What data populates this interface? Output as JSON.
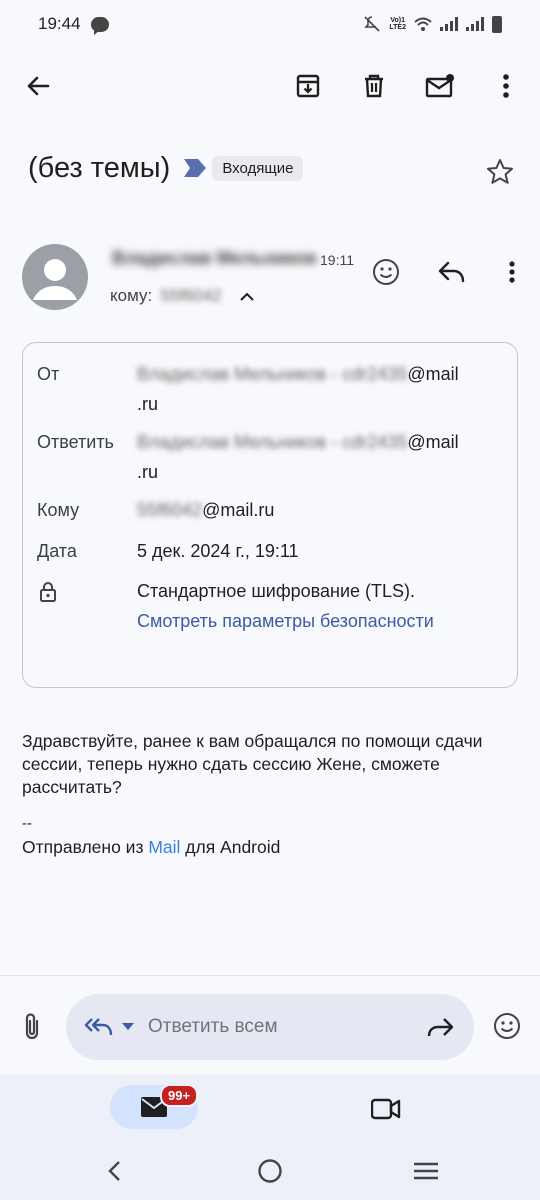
{
  "status_bar": {
    "time": "19:44",
    "volte_top": "Vo)1",
    "volte_bottom": "LTE2"
  },
  "toolbar": {
    "back_icon": "arrow-back-icon",
    "archive_icon": "archive-icon",
    "delete_icon": "trash-icon",
    "unread_icon": "mark-unread-icon",
    "more_icon": "more-vert-icon"
  },
  "message": {
    "subject": "(без темы)",
    "label": "Входящие",
    "sender_name": "Владислав Мельников",
    "time": "19:11",
    "to_prefix": "кому:",
    "to_masked": "55f6042"
  },
  "details": {
    "from_label": "От",
    "from_masked": "Владислав Мельников - cdr2435",
    "from_domain": "@mail",
    "from_tld": ".ru",
    "reply_label": "Ответить",
    "reply_masked": "Владислав Мельников - cdr2435",
    "reply_domain": "@mail",
    "reply_tld": ".ru",
    "to_label": "Кому",
    "to_masked": "55f6042",
    "to_domain": "@mail.ru",
    "date_label": "Дата",
    "date_value": "5 дек. 2024 г., 19:11",
    "encryption": "Стандартное шифрование (TLS).",
    "security_link": "Смотреть параметры безопасности"
  },
  "body": {
    "text": "Здравствуйте, ранее к вам обращался по помощи сдачи сессии, теперь нужно сдать сессию Жене, сможете рассчитать?",
    "sig_sep": "--",
    "sig_prefix": "Отправлено из ",
    "sig_link": "Mail",
    "sig_suffix": " для Android"
  },
  "reply": {
    "placeholder": "Ответить всем"
  },
  "bottom_nav": {
    "badge": "99+"
  },
  "colors": {
    "accent_link": "#3b5ba5",
    "badge_red": "#c5221f",
    "label_arrow": "#5a6fb0"
  }
}
